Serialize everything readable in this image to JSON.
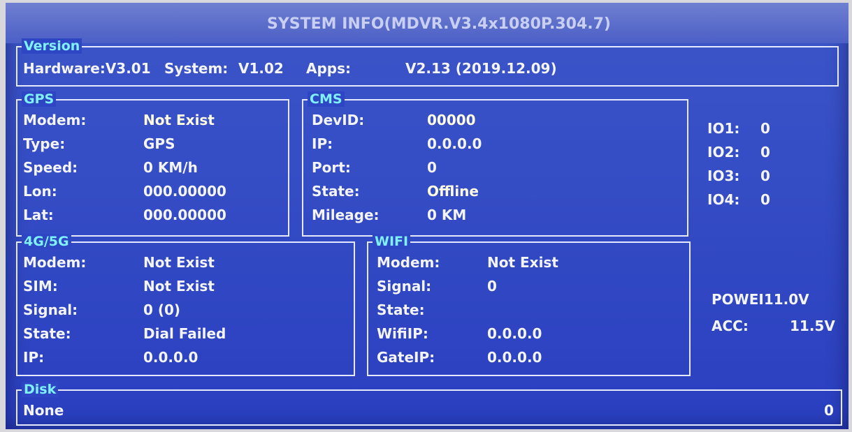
{
  "window": {
    "title": "SYSTEM INFO(MDVR.V3.4x1080P.304.7)"
  },
  "version": {
    "legend": "Version",
    "hardware": "Hardware:V3.01",
    "system_label": "System:",
    "system_value": "V1.02",
    "apps_label": "Apps:",
    "apps_value": "V2.13 (2019.12.09)"
  },
  "gps": {
    "legend": "GPS",
    "rows": [
      {
        "label": "Modem:",
        "value": "Not Exist"
      },
      {
        "label": "Type:",
        "value": "GPS"
      },
      {
        "label": "Speed:",
        "value": "0 KM/h"
      },
      {
        "label": "Lon:",
        "value": "000.00000"
      },
      {
        "label": "Lat:",
        "value": "000.00000"
      }
    ]
  },
  "cms": {
    "legend": "CMS",
    "rows": [
      {
        "label": "DevID:",
        "value": "00000"
      },
      {
        "label": "IP:",
        "value": "0.0.0.0"
      },
      {
        "label": "Port:",
        "value": "0"
      },
      {
        "label": "State:",
        "value": "Offline"
      },
      {
        "label": "Mileage:",
        "value": "0 KM"
      }
    ]
  },
  "io": [
    {
      "label": "IO1:",
      "value": "0"
    },
    {
      "label": "IO2:",
      "value": "0"
    },
    {
      "label": "IO3:",
      "value": "0"
    },
    {
      "label": "IO4:",
      "value": "0"
    }
  ],
  "cellular": {
    "legend": "4G/5G",
    "rows": [
      {
        "label": "Modem:",
        "value": "Not Exist"
      },
      {
        "label": "SIM:",
        "value": "Not Exist"
      },
      {
        "label": "Signal:",
        "value": "0 (0)"
      },
      {
        "label": "State:",
        "value": "Dial Failed"
      },
      {
        "label": "IP:",
        "value": "0.0.0.0"
      }
    ]
  },
  "wifi": {
    "legend": "WIFI",
    "rows": [
      {
        "label": "Modem:",
        "value": "Not Exist"
      },
      {
        "label": "Signal:",
        "value": "0"
      },
      {
        "label": "State:",
        "value": ""
      },
      {
        "label": "WifiIP:",
        "value": "0.0.0.0"
      },
      {
        "label": "GateIP:",
        "value": "0.0.0.0"
      }
    ]
  },
  "power": {
    "power_text": "POWEI11.0V",
    "acc_label": "ACC:",
    "acc_value": "11.5V"
  },
  "disk": {
    "legend": "Disk",
    "value": "None",
    "count": "0"
  }
}
